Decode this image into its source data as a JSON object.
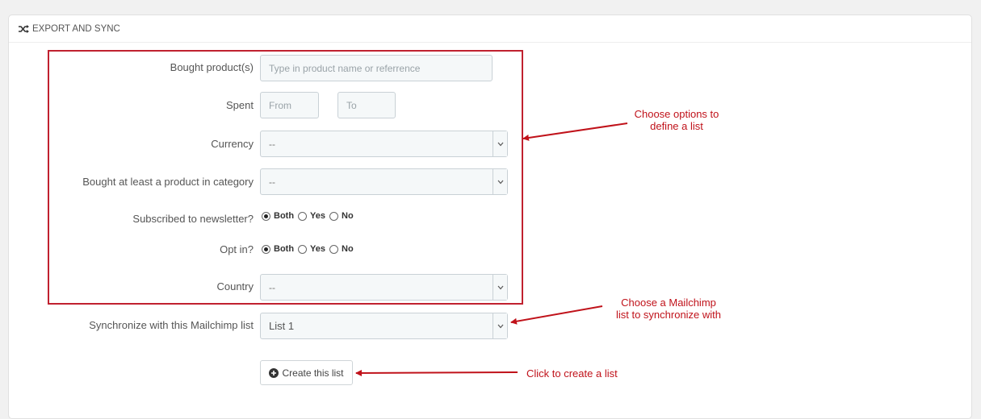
{
  "header": {
    "title": "EXPORT AND SYNC",
    "icon": "shuffle-icon"
  },
  "form": {
    "bought_products": {
      "label": "Bought product(s)",
      "placeholder": "Type in product name or referrence"
    },
    "spent": {
      "label": "Spent",
      "from_placeholder": "From",
      "to_placeholder": "To"
    },
    "currency": {
      "label": "Currency",
      "value": "--"
    },
    "category": {
      "label": "Bought at least a product in category",
      "value": "--"
    },
    "newsletter": {
      "label": "Subscribed to newsletter?",
      "options": [
        "Both",
        "Yes",
        "No"
      ],
      "selected": "Both"
    },
    "optin": {
      "label": "Opt in?",
      "options": [
        "Both",
        "Yes",
        "No"
      ],
      "selected": "Both"
    },
    "country": {
      "label": "Country",
      "value": "--"
    },
    "mailchimp": {
      "label": "Synchronize with this Mailchimp list",
      "value": "List 1"
    }
  },
  "create_button": {
    "label": "Create this list",
    "icon": "plus-circle-icon"
  },
  "annotations": {
    "options": [
      "Choose options to",
      "define a list"
    ],
    "mailchimp": [
      "Choose a Mailchimp",
      "list to synchronize with"
    ],
    "create": "Click to create a list"
  },
  "colors": {
    "annotation_red": "#c0121a",
    "highlight_box": "#c0212f"
  }
}
